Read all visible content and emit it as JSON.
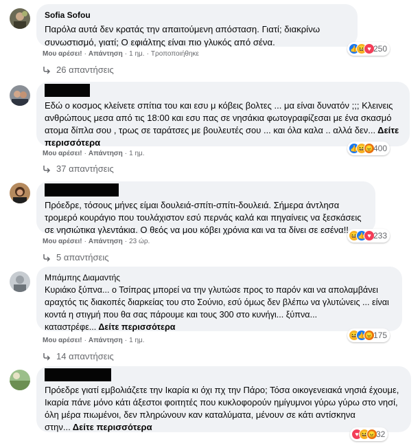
{
  "comments": [
    {
      "author": "Sofia Sofou",
      "text": "Παρόλα αυτά δεν κρατάς την απαιτούμενη απόσταση. Γιατί; διακρίνω συνωστισμό, γιατί; Ο εφιάλτης είναι πιο γλυκός από σένα.",
      "more": "",
      "like": "Μου αρέσει!",
      "reply": "Απάντηση",
      "time": "1 ημ.",
      "edited": "Τροποποιήθηκε",
      "reactions": [
        "like-icon",
        "haha-icon",
        "love-icon"
      ],
      "reaction_count": "250",
      "replies": "26 απαντήσεις"
    },
    {
      "author": "",
      "text": "Εδώ ο κοσμος κλείνετε σπίτια του και εσυ μ κόβεις βολτες ... μα είναι δυνατόν ;;; Κλεινεις ανθρώπους μεσα από τις 18:00 και εσυ πας σε νησάκια φωτογραφίζεσαι με ένα σκασμό ατομα δίπλα σου , τρως σε ταράτσες με βουλευτές σου ... και όλα καλα .. αλλά δεν...",
      "more": "Δείτε περισσότερα",
      "like": "Μου αρέσει!",
      "reply": "Απάντηση",
      "time": "1 ημ.",
      "edited": "",
      "reactions": [
        "like-icon",
        "haha-icon",
        "angry-icon"
      ],
      "reaction_count": "400",
      "replies": "37 απαντήσεις"
    },
    {
      "author": "",
      "text": "Πρόεδρε, τόσους μήνες είμαι δουλειά-σπίτι-σπίτι-δουλειά. Σήμερα άντλησα τρομερό κουράγιο που τουλάχιστον εσύ περνάς καλά και πηγαίνεις να ξεσκάσεις σε νησιώτικα γλεντάκια. Ο θεός να μου κόβει χρόνια και να τα δίνει σε εσένα!!",
      "more": "",
      "like": "Μου αρέσει!",
      "reply": "Απάντηση",
      "time": "23 ώρ.",
      "edited": "",
      "reactions": [
        "haha-icon",
        "like-icon",
        "love-icon"
      ],
      "reaction_count": "233",
      "replies": "5 απαντήσεις"
    },
    {
      "author": "Μπάμπης Διαμαντής",
      "text": "Κυριάκο ξύπνα... ο Τσίπρας μπορεί να την γλυτώσε προς το παρόν και να απολαμβάνει αραχτός τις διακοπές διαρκείας του στο Σούνιο, εσύ όμως δεν βλέπω να γλυτώνεις ... είναι κοντά η στιγμή που θα σας πάρουμε και τους 300 στο κυνήγι... ξύπνα... καταστρέφε...",
      "more": "Δείτε περισσότερα",
      "like": "Μου αρέσει!",
      "reply": "Απάντηση",
      "time": "1 ημ.",
      "edited": "",
      "reactions": [
        "haha-icon",
        "like-icon",
        "angry-icon"
      ],
      "reaction_count": "175",
      "replies": "14 απαντήσεις"
    },
    {
      "author": "",
      "text": "Πρόεδρε γιατί εμβολιάζετε την Ικαρία κι όχι πχ την Πάρο; Τόσα οικογενειακά νησιά έχουμε, Ικαρία πάνε μόνο κάτι άξεστοι φοιτητές που κυκλοφορούν ημίγυμνοι γύρω γύρω στο νησί, όλη μέρα πιωμένοι, δεν πληρώνουν καν καταλύματα, μένουν σε κάτι αντίσκηνα στην...",
      "more": "Δείτε περισσότερα",
      "like": "",
      "reply": "",
      "time": "",
      "edited": "",
      "reactions": [
        "love-icon",
        "haha-icon",
        "angry-icon"
      ],
      "reaction_count": "32",
      "replies": ""
    }
  ]
}
